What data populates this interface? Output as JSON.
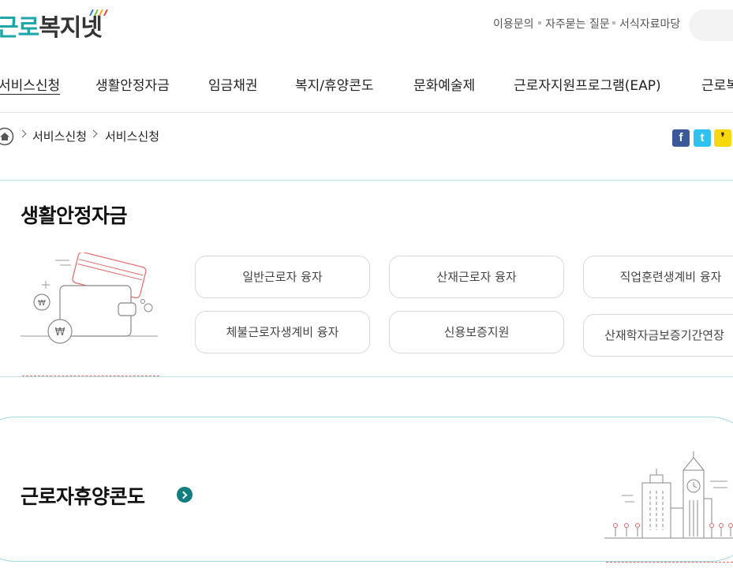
{
  "logo": {
    "part1": "근로",
    "part2": "복지넷"
  },
  "utility": {
    "items": [
      "이용문의",
      "자주묻는 질문",
      "서식자료마당"
    ]
  },
  "gnb": {
    "items": [
      "서비스신청",
      "생활안정자금",
      "임금채권",
      "복지/휴양콘도",
      "문화예술제",
      "근로자지원프로그램(EAP)",
      "근로복"
    ]
  },
  "breadcrumb": {
    "items": [
      "서비스신청",
      "서비스신청"
    ]
  },
  "share": {
    "facebook": "f",
    "twitter": "t",
    "kakao": "❜"
  },
  "loan": {
    "title": "생활안정자금",
    "buttons": [
      "일반근로자 융자",
      "산재근로자 융자",
      "직업훈련생계비 융자",
      "체불근로자생계비 융자",
      "신용보증지원",
      "산재학자금보증기간연장"
    ],
    "coin_symbol": "₩"
  },
  "condo": {
    "title": "근로자휴양콘도"
  },
  "colors": {
    "accent": "#1fa6a8",
    "dark_accent": "#137d7f",
    "dash": "#e06a6a",
    "line": "#9fd8d8"
  }
}
